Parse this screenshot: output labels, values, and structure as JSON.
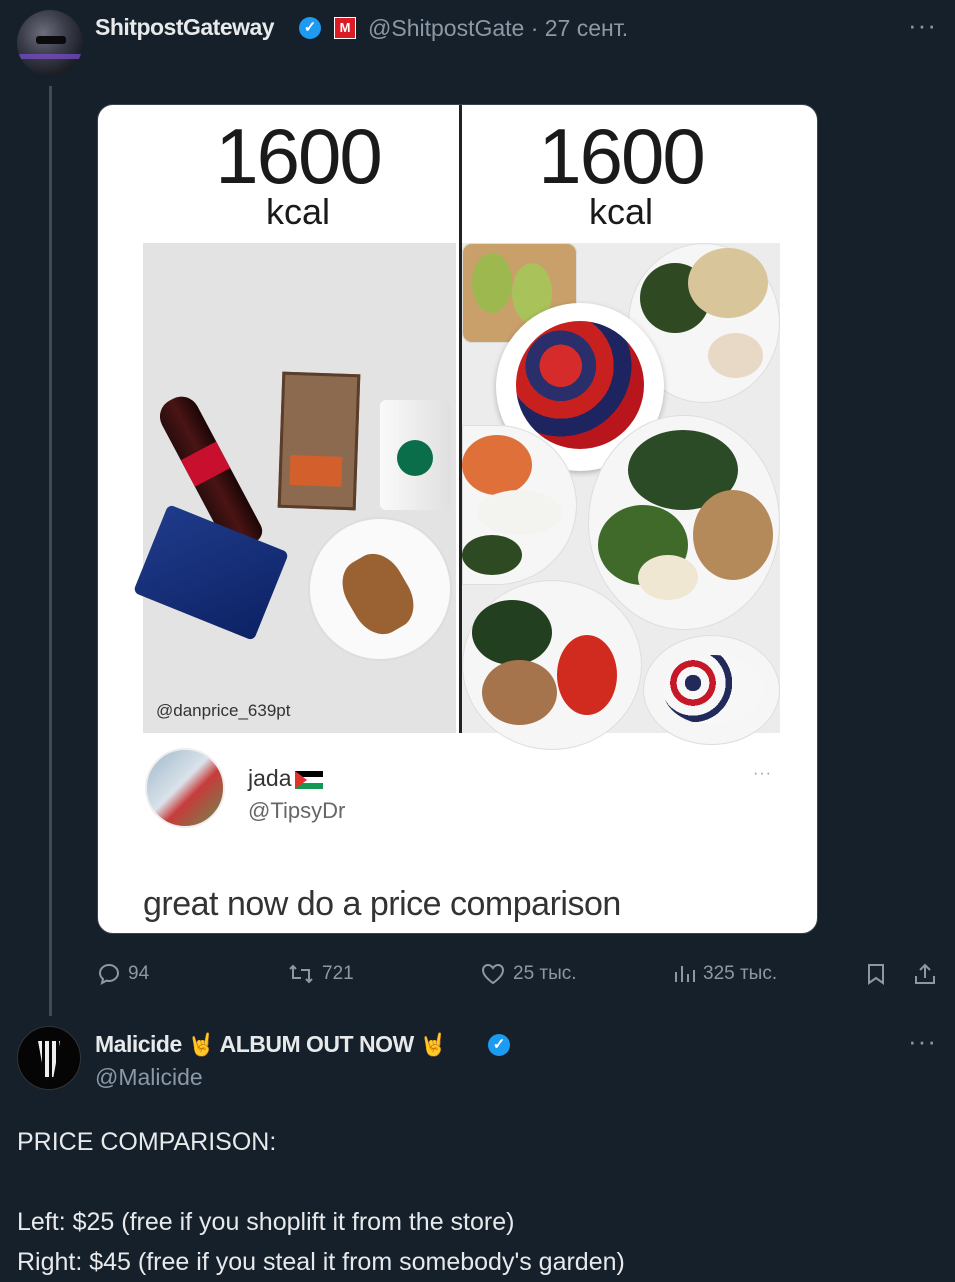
{
  "tweet1": {
    "display_name": "ShitpostGateway",
    "handle_date": "@ShitpostGate · 27 сент.",
    "verified_mark": "✓",
    "affiliate_label": "M",
    "more": "···",
    "stats": {
      "replies": "94",
      "retweets": "721",
      "likes": "25 тыс.",
      "views": "325 тыс."
    },
    "icons": [
      "reply-icon",
      "retweet-icon",
      "like-icon",
      "views-icon",
      "bookmark-icon",
      "share-icon"
    ]
  },
  "media": {
    "left_kcal": "1600",
    "left_unit": "kcal",
    "right_kcal": "1600",
    "right_unit": "kcal",
    "credit": "@danprice_639pt",
    "quote": {
      "name": "jada",
      "handle": "@TipsyDr",
      "more": "···",
      "text": "great now do a price comparison"
    }
  },
  "tweet2": {
    "display_name_a": "Malicide",
    "display_name_b": "ALBUM OUT NOW",
    "emoji": "🤘",
    "verified_mark": "✓",
    "handle": "@Malicide",
    "more": "···",
    "body": "PRICE COMPARISON:\n\nLeft: $25 (free if you shoplift it from the store)\nRight: $45 (free if you steal it from somebody's garden)"
  },
  "colors": {
    "background": "#15202b",
    "text": "#e7e9ea",
    "muted": "#8b98a5",
    "verified": "#1d9bf0"
  }
}
